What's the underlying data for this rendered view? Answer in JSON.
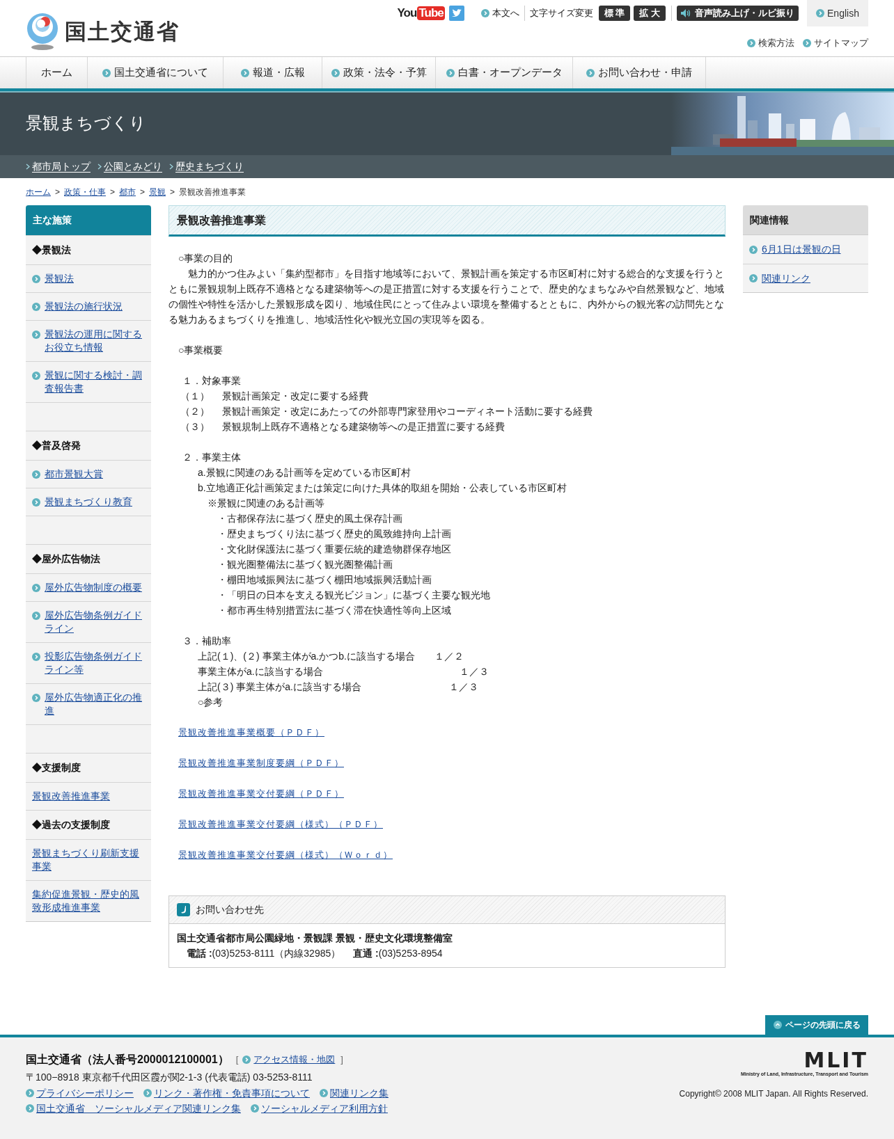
{
  "header": {
    "logo_text": "国土交通省",
    "video_logo": [
      "You",
      "Tube"
    ],
    "skip_link": "本文へ",
    "font_size_label": "文字サイズ変更",
    "font_size_buttons": [
      "標 準",
      "拡 大"
    ],
    "speech_button": "音声読み上げ・ルビ振り",
    "language_link": "English",
    "sub_links": [
      "検索方法",
      "サイトマップ"
    ]
  },
  "nav": [
    {
      "label": "ホーム",
      "kind": "home"
    },
    {
      "label": "国土交通省について",
      "kind": "link"
    },
    {
      "label": "報道・広報",
      "kind": "link"
    },
    {
      "label": "政策・法令・予算",
      "kind": "link"
    },
    {
      "label": "白書・オープンデータ",
      "kind": "link"
    },
    {
      "label": "お問い合わせ・申請",
      "kind": "link"
    }
  ],
  "banner": {
    "title": "景観まちづくり",
    "sub_links": [
      "都市局トップ",
      "公園とみどり",
      "歴史まちづくり"
    ]
  },
  "breadcrumb": {
    "separator": ">",
    "items": [
      {
        "label": "ホーム",
        "link": true
      },
      {
        "label": "政策・仕事",
        "link": true
      },
      {
        "label": "都市",
        "link": true
      },
      {
        "label": "景観",
        "link": true
      },
      {
        "label": "景観改善推進事業",
        "link": false
      }
    ]
  },
  "left_sidebar": {
    "title": "主な施策",
    "items": [
      {
        "kind": "heading",
        "label": "◆景観法"
      },
      {
        "kind": "link",
        "label": "景観法"
      },
      {
        "kind": "link",
        "label": "景観法の施行状況"
      },
      {
        "kind": "link",
        "label": "景観法の運用に関するお役立ち情報"
      },
      {
        "kind": "link",
        "label": "景観に関する検討・調査報告書"
      },
      {
        "kind": "spacer"
      },
      {
        "kind": "heading",
        "label": "◆普及啓発"
      },
      {
        "kind": "link",
        "label": "都市景観大賞"
      },
      {
        "kind": "link",
        "label": "景観まちづくり教育"
      },
      {
        "kind": "spacer"
      },
      {
        "kind": "heading",
        "label": "◆屋外広告物法"
      },
      {
        "kind": "link",
        "label": "屋外広告物制度の概要"
      },
      {
        "kind": "link",
        "label": "屋外広告物条例ガイドライン"
      },
      {
        "kind": "link",
        "label": "投影広告物条例ガイドライン等"
      },
      {
        "kind": "link",
        "label": "屋外広告物適正化の推進"
      },
      {
        "kind": "spacer"
      },
      {
        "kind": "heading",
        "label": "◆支援制度"
      },
      {
        "kind": "plain_link",
        "label": "景観改善推進事業"
      },
      {
        "kind": "heading",
        "label": "◆過去の支援制度"
      },
      {
        "kind": "plain_link",
        "label": "景観まちづくり刷新支援事業"
      },
      {
        "kind": "plain_link",
        "label": "集約促進景観・歴史的風致形成推進事業"
      }
    ]
  },
  "main": {
    "title": "景観改善推進事業",
    "body": [
      {
        "kind": "section",
        "text": "○事業の目的"
      },
      {
        "kind": "paragraph",
        "text": "魅力的かつ住みよい「集約型都市」を目指す地域等において、景観計画を策定する市区町村に対する総合的な支援を行うとともに景観規制上既存不適格となる建築物等への是正措置に対する支援を行うことで、歴史的なまちなみや自然景観など、地域の個性や特性を活かした景観形成を図り、地域住民にとって住みよい環境を整備するとともに、内外からの観光客の訪問先となる魅力あるまちづくりを推進し、地域活性化や観光立国の実現等を図る。"
      },
      {
        "kind": "section",
        "text": "○事業概要"
      },
      {
        "kind": "numbered",
        "text": "１．対象事業"
      },
      {
        "kind": "sub",
        "text": "（１）　 景観計画策定・改定に要する経費"
      },
      {
        "kind": "sub",
        "text": "（２）　 景観計画策定・改定にあたっての外部専門家登用やコーディネート活動に要する経費"
      },
      {
        "kind": "sub",
        "text": "（３）　 景観規制上既存不適格となる建築物等への是正措置に要する経費"
      },
      {
        "kind": "numbered",
        "text": "２．事業主体"
      },
      {
        "kind": "alpha",
        "text": "a.景観に関連のある計画等を定めている市区町村"
      },
      {
        "kind": "alpha",
        "text": "b.立地適正化計画策定または策定に向けた具体的取組を開始・公表している市区町村"
      },
      {
        "kind": "note",
        "text": "※景観に関連のある計画等"
      },
      {
        "kind": "bullet",
        "text": "・古都保存法に基づく歴史的風土保存計画"
      },
      {
        "kind": "bullet",
        "text": "・歴史まちづくり法に基づく歴史的風致維持向上計画"
      },
      {
        "kind": "bullet",
        "text": "・文化財保護法に基づく重要伝統的建造物群保存地区"
      },
      {
        "kind": "bullet",
        "text": "・観光圏整備法に基づく観光圏整備計画"
      },
      {
        "kind": "bullet",
        "text": "・棚田地域振興法に基づく棚田地域振興活動計画"
      },
      {
        "kind": "bullet",
        "text": "・「明日の日本を支える観光ビジョン」に基づく主要な観光地"
      },
      {
        "kind": "bullet",
        "text": "・都市再生特別措置法に基づく滞在快適性等向上区域"
      },
      {
        "kind": "numbered",
        "text": "３．補助率"
      },
      {
        "kind": "alpha",
        "text": "上記(１)、(２) 事業主体がa.かつb.に該当する場合　　１／２"
      },
      {
        "kind": "alpha",
        "text": "事業主体がa.に該当する場合　　　　　　　　　　　　　　１／３"
      },
      {
        "kind": "alpha",
        "text": "上記(３) 事業主体がa.に該当する場合　　　　　　　　　１／３"
      },
      {
        "kind": "alpha",
        "text": "○参考"
      }
    ],
    "documents": [
      "景観改善推進事業概要（ＰＤＦ）",
      "景観改善推進事業制度要綱（ＰＤＦ）",
      "景観改善推進事業交付要綱（ＰＤＦ）",
      "景観改善推進事業交付要綱（様式）（ＰＤＦ）",
      "景観改善推進事業交付要綱（様式）（Ｗｏｒｄ）"
    ],
    "contact": {
      "title": "お問い合わせ先",
      "office": "国土交通省都市局公園緑地・景観課 景観・歴史文化環境整備室",
      "phone": "**電話 :**(03)5253-8111（内線32985）　 **直通 :**(03)5253-8954"
    }
  },
  "right_sidebar": {
    "title": "関連情報",
    "items": [
      "6月1日は景観の日",
      "関連リンク"
    ]
  },
  "footer": {
    "page_top": "ページの先頭に戻る",
    "org": "国土交通省（法人番号2000012100001）",
    "access": {
      "open": "[",
      "label": "アクセス情報・地図",
      "close": "]"
    },
    "address": "〒100−8918 東京都千代田区霞が関2-1-3 (代表電話) 03-5253-8111",
    "link_rows": [
      [
        "プライバシーポリシー",
        "リンク・著作権・免責事項について",
        "関連リンク集"
      ],
      [
        "国土交通省　ソーシャルメディア関連リンク集",
        "ソーシャルメディア利用方針"
      ]
    ],
    "logo": "MLIT",
    "logo_caption": "Ministry of Land, Infrastructure, Transport and Tourism",
    "copyright": "Copyright© 2008 MLIT Japan. All Rights Reserved."
  }
}
